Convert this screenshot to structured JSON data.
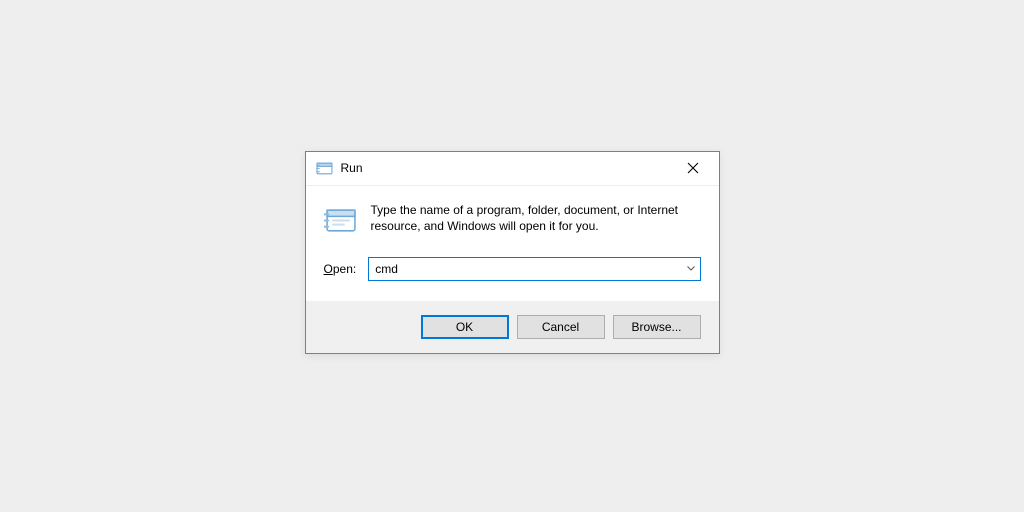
{
  "dialog": {
    "title": "Run",
    "description": "Type the name of a program, folder, document, or Internet resource, and Windows will open it for you.",
    "open_label_prefix": "O",
    "open_label_rest": "pen:",
    "input_value": "cmd",
    "buttons": {
      "ok": "OK",
      "cancel": "Cancel",
      "browse": "Browse..."
    }
  }
}
